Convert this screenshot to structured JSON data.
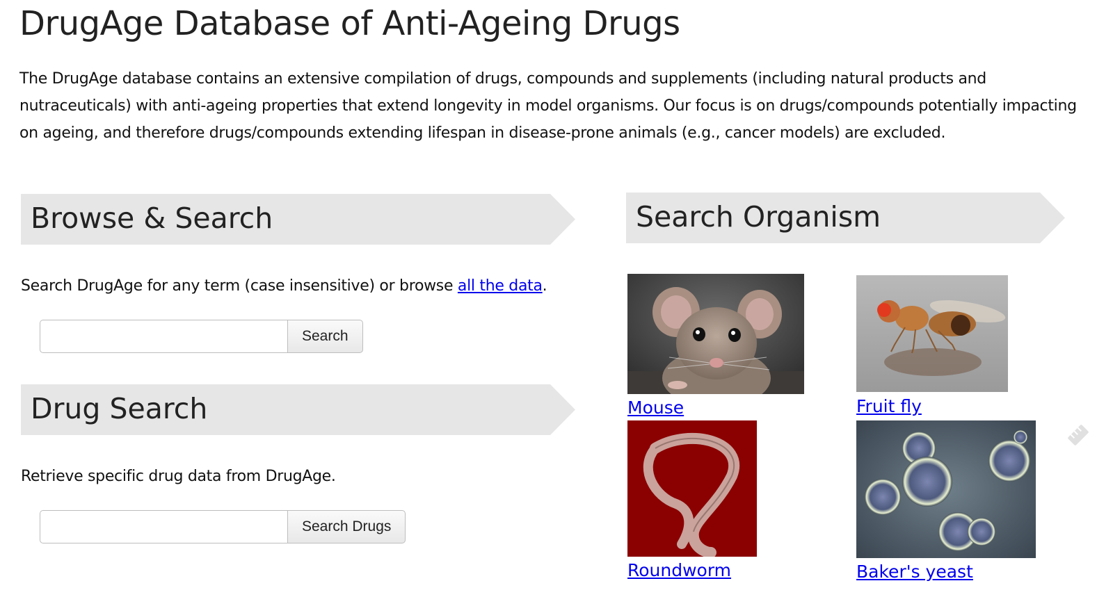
{
  "page": {
    "title": "DrugAge Database of Anti-Ageing Drugs",
    "intro": "The DrugAge database contains an extensive compilation of drugs, compounds and supplements (including natural products and nutraceuticals) with anti-ageing properties that extend longevity in model organisms. Our focus is on drugs/compounds potentially impacting on ageing, and therefore drugs/compounds extending lifespan in disease-prone animals (e.g., cancer models) are excluded."
  },
  "browse": {
    "heading": "Browse & Search",
    "text_before": "Search DrugAge for any term (case insensitive) or browse ",
    "link": "all the data",
    "text_after": ".",
    "input_value": "",
    "button": "Search"
  },
  "drug_search": {
    "heading": "Drug Search",
    "text": "Retrieve specific drug data from DrugAge.",
    "input_value": "",
    "button": "Search Drugs"
  },
  "organisms": {
    "heading": "Search Organism",
    "items": [
      {
        "name": "Mouse",
        "icon": "mouse-photo"
      },
      {
        "name": "Fruit fly",
        "icon": "fruit-fly-photo"
      },
      {
        "name": "Roundworm",
        "icon": "roundworm-photo"
      },
      {
        "name": "Baker's yeast",
        "icon": "yeast-photo"
      }
    ]
  },
  "side_widget": {
    "icon": "ruler-icon"
  },
  "colors": {
    "banner": "#e6e6e6",
    "link": "#0000ee",
    "worm_bg": "#8b0000"
  }
}
